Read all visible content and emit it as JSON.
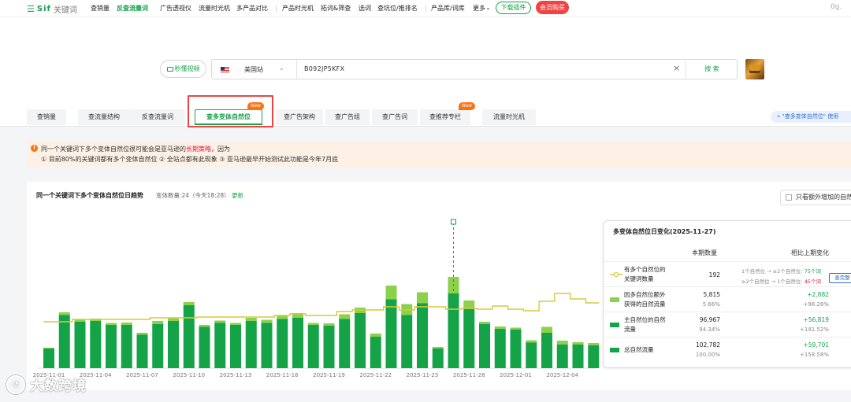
{
  "nav": {
    "brand": "Sif",
    "brand_sub": "关键词",
    "items": [
      "查销量",
      "反查流量词",
      "广告透视仪",
      "流量时光机",
      "多产品对比",
      "产品时光机",
      "拓词&筛查",
      "选词",
      "查坑位/推排名",
      "产品库/词库",
      "更多"
    ],
    "download": "下载插件",
    "vip": "会员购买",
    "user": "0g."
  },
  "search": {
    "video": "秒懂视频",
    "site": "美国站",
    "asin": "B092JP5KFX",
    "button": "搜 索"
  },
  "tabs": [
    "查销量",
    "查流量结构",
    "反查流量词",
    "查多变体自然位",
    "查广告架构",
    "查广告组",
    "查广告词",
    "查推荐专栏",
    "流量时光机"
  ],
  "new_badge": "New",
  "tab_tip": "\"查多变体自然位\" 使用",
  "notice": {
    "line1_a": "同一个关键词下多个变体自然位很可能会是亚马逊的",
    "line1_red": "长期策略",
    "line1_b": "，因为",
    "line2": "① 目前80%的关键词都有多个变体自然位 ② 全站点都有此现象 ③ 亚马逊最早开始测试此功能是今年7月底"
  },
  "panel": {
    "title": "同一个关键词下多个变体自然位日趋势",
    "meta": "变体数量:24（今天18:28）",
    "meta_link": "更新",
    "checkbox_label": "只看额外增加的自然"
  },
  "legend": {
    "title": "多变体自然位日变化(2025-11-27)",
    "col_value": "本期数量",
    "col_change": "相比上期变化",
    "button": "查完整",
    "rows": [
      {
        "label1": "有多个自然位的",
        "label2": "关键词数量",
        "value": "192",
        "pct": "",
        "change": "",
        "change_pct": "",
        "sub1": "1个自然位 → ≥2个自然位: ",
        "sub1v": "75个词",
        "sub2": "≥2个自然位 → 1个自然位: ",
        "sub2v": "45个词"
      },
      {
        "label1": "因多自然位额外",
        "label2": "获得的自然流量",
        "value": "5,815",
        "pct": "5.66%",
        "change": "+2,882",
        "change_pct": "+98.28%"
      },
      {
        "label1": "主自然位的自然",
        "label2": "流量",
        "value": "96,967",
        "pct": "94.34%",
        "change": "+56,819",
        "change_pct": "+141.52%"
      },
      {
        "label1": "总自然流量",
        "label2": "",
        "value": "102,782",
        "pct": "100.00%",
        "change": "+59,701",
        "change_pct": "+158.58%"
      }
    ],
    "colors": {
      "line": "#d9c93a",
      "extra": "#8bd14b",
      "main": "#15a348",
      "total": "#15a348"
    }
  },
  "watermark": "大数跨境",
  "chart_data": {
    "type": "bar",
    "categories": [
      "2025-11-01",
      "2025-11-02",
      "2025-11-03",
      "2025-11-04",
      "2025-11-05",
      "2025-11-06",
      "2025-11-07",
      "2025-11-08",
      "2025-11-09",
      "2025-11-10",
      "2025-11-11",
      "2025-11-12",
      "2025-11-13",
      "2025-11-14",
      "2025-11-15",
      "2025-11-16",
      "2025-11-17",
      "2025-11-18",
      "2025-11-19",
      "2025-11-20",
      "2025-11-21",
      "2025-11-22",
      "2025-11-23",
      "2025-11-24",
      "2025-11-25",
      "2025-11-26",
      "2025-11-27",
      "2025-11-28",
      "2025-11-29",
      "2025-11-30",
      "2025-12-01",
      "2025-12-02",
      "2025-12-03",
      "2025-12-04",
      "2025-12-05",
      "2025-12-06"
    ],
    "x_tick_labels": [
      "2025-11-01",
      "2025-11-04",
      "2025-11-07",
      "2025-11-10",
      "2025-11-13",
      "2025-11-16",
      "2025-11-19",
      "2025-11-22",
      "2025-11-25",
      "2025-11-28",
      "2025-12-01",
      "2025-12-04"
    ],
    "series": [
      {
        "type": "bar",
        "values": [
          50,
          135,
          118,
          120,
          110,
          110,
          85,
          112,
          120,
          160,
          105,
          115,
          110,
          120,
          115,
          125,
          128,
          110,
          108,
          125,
          140,
          80,
          175,
          135,
          165,
          50,
          190,
          152,
          112,
          100,
          98,
          65,
          90,
          60,
          60,
          58
        ]
      },
      {
        "type": "bar",
        "values": [
          2,
          7,
          7,
          6,
          5,
          6,
          5,
          8,
          8,
          8,
          5,
          6,
          5,
          8,
          8,
          10,
          12,
          5,
          6,
          12,
          14,
          8,
          35,
          28,
          28,
          4,
          42,
          20,
          6,
          6,
          5,
          6,
          15,
          10,
          6,
          6
        ]
      },
      {
        "type": "line",
        "values": [
          118,
          118,
          124,
          124,
          124,
          124,
          124,
          128,
          128,
          128,
          130,
          130,
          130,
          130,
          130,
          134,
          138,
          134,
          134,
          144,
          148,
          148,
          156,
          148,
          156,
          156,
          150,
          152,
          150,
          158,
          150,
          146,
          170,
          190,
          176,
          166
        ]
      }
    ],
    "grid": false
  }
}
